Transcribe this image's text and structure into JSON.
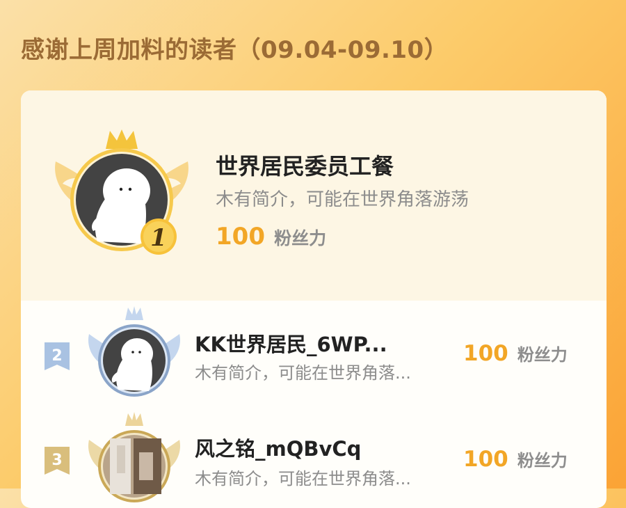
{
  "page": {
    "title": "感谢上周加料的读者（09.04-09.10）"
  },
  "ranking": [
    {
      "rank": "1",
      "name": "世界居民委员工餐",
      "bio": "木有简介，可能在世界角落游荡",
      "fans": "100",
      "fans_unit": "粉丝力"
    },
    {
      "rank": "2",
      "name": "KK世界居民_6WP...",
      "bio": "木有简介，可能在世界角落...",
      "fans": "100",
      "fans_unit": "粉丝力"
    },
    {
      "rank": "3",
      "name": "风之铭_mQBvCq",
      "bio": "木有简介，可能在世界角落...",
      "fans": "100",
      "fans_unit": "粉丝力"
    }
  ],
  "colors": {
    "gold": "#f2a626",
    "silver": "#9db4d4",
    "bronze": "#d4b46a"
  }
}
